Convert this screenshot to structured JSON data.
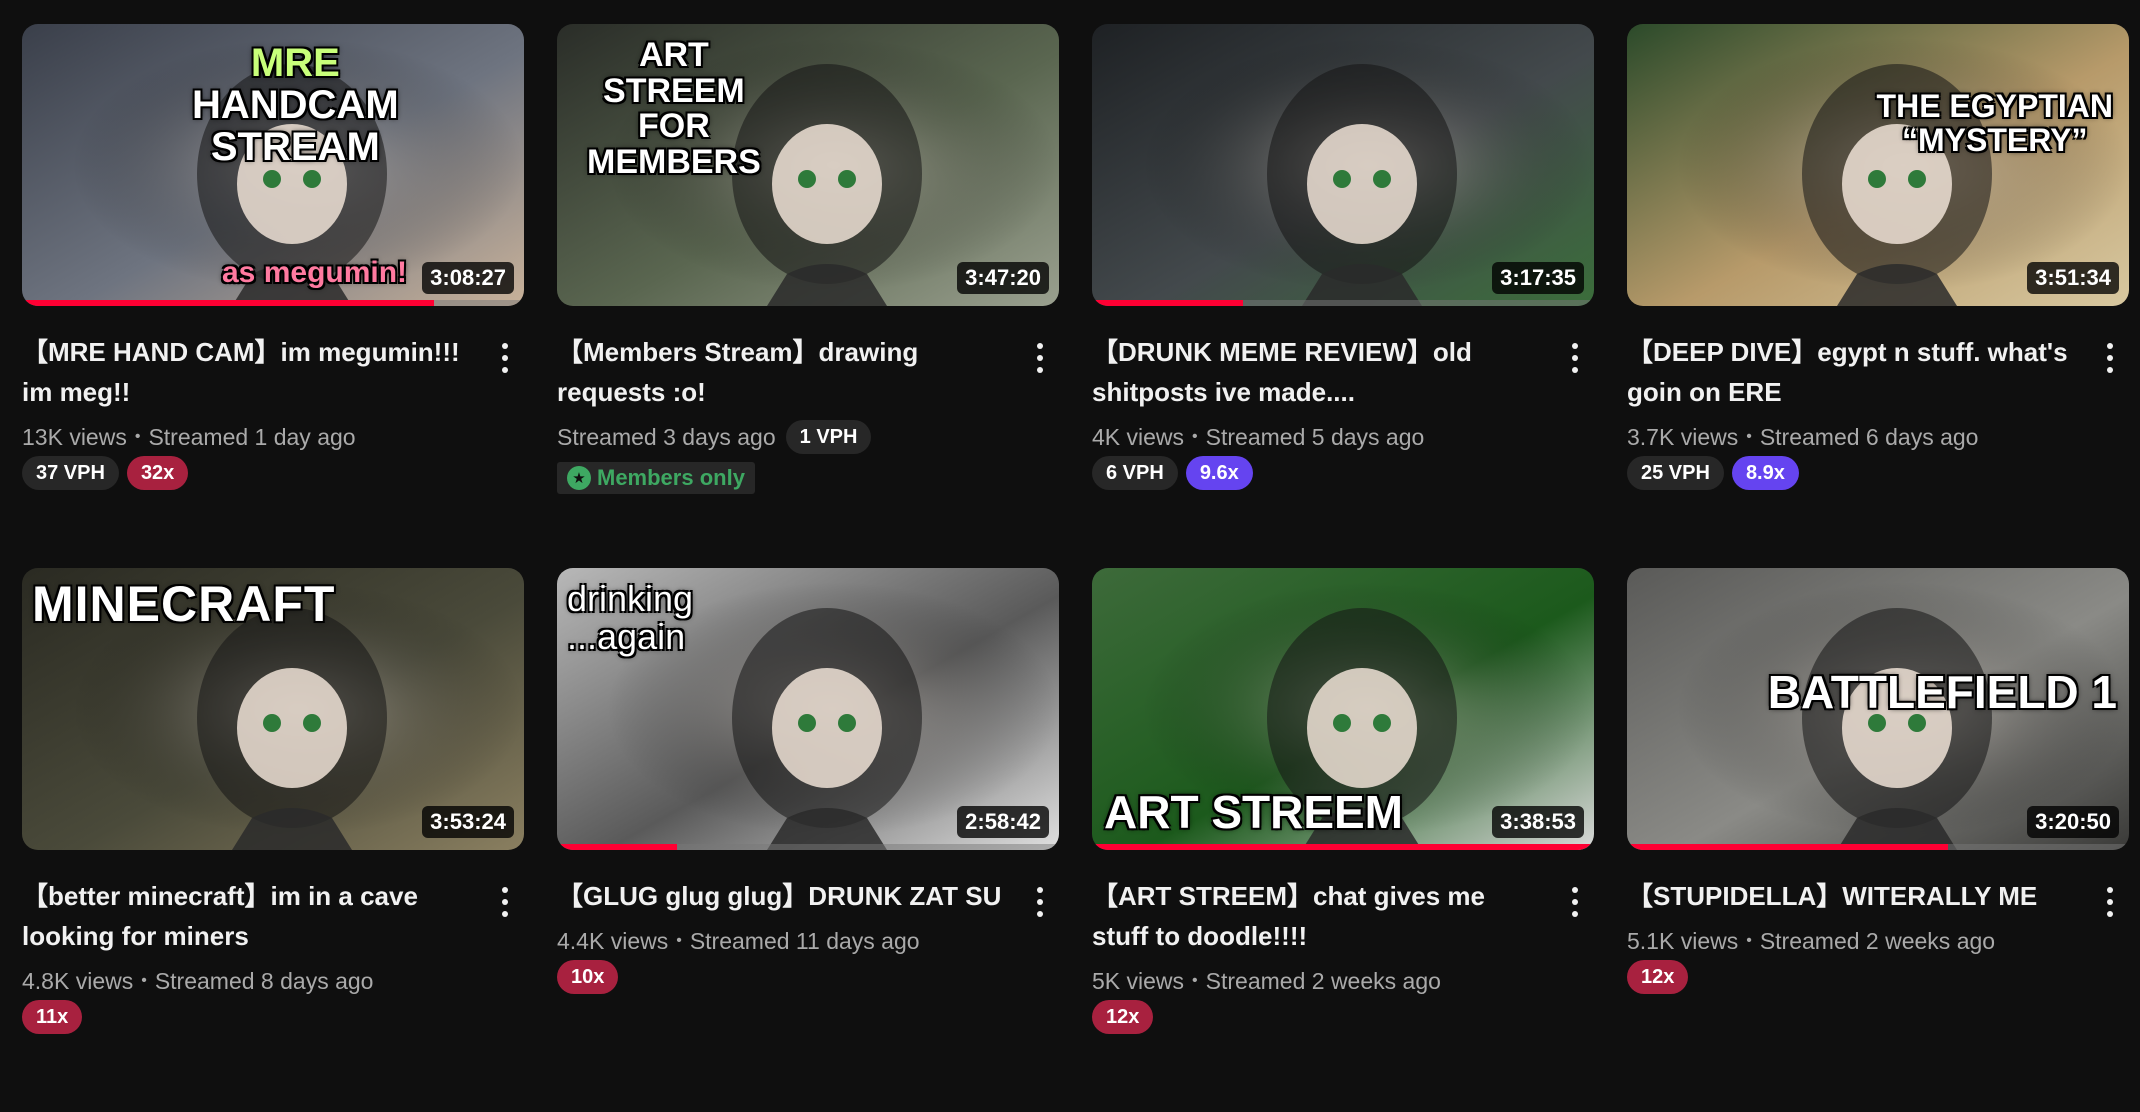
{
  "videos": [
    {
      "title": "【MRE HAND CAM】im megumin!!! im meg!!",
      "thumb_text": [
        "MRE",
        "HANDCAM",
        "STREAM"
      ],
      "thumb_sub": "as megumin!",
      "duration": "3:08:27",
      "progress": 0.82,
      "views": "13K views",
      "date": "Streamed 1 day ago",
      "vph": "37 VPH",
      "mult": "32x",
      "mult_color": "red",
      "bg": [
        "#3a3f4a",
        "#6e7480",
        "#c9b29a"
      ]
    },
    {
      "title": "【Members Stream】drawing requests :o!",
      "thumb_text": [
        "ART",
        "STREEM",
        "FOR",
        "MEMBERS"
      ],
      "duration": "3:47:20",
      "progress": 0,
      "views": "",
      "date": "Streamed 3 days ago",
      "vph": "1 VPH",
      "members_label": "Members only",
      "bg": [
        "#2a2d28",
        "#5a6650",
        "#9aa08f"
      ]
    },
    {
      "title": "【DRUNK MEME REVIEW】old shitposts ive made....",
      "duration": "3:17:35",
      "progress": 0.3,
      "views": "4K views",
      "date": "Streamed 5 days ago",
      "vph": "6 VPH",
      "mult": "9.6x",
      "mult_color": "purple",
      "bg": [
        "#1e2124",
        "#43494c",
        "#3b6e3b"
      ]
    },
    {
      "title": "【DEEP DIVE】egypt n stuff. what's goin on ERE",
      "thumb_text": [
        "THE EGYPTIAN",
        "“MYSTERY”"
      ],
      "duration": "3:51:34",
      "progress": 0,
      "views": "3.7K views",
      "date": "Streamed 6 days ago",
      "vph": "25 VPH",
      "mult": "8.9x",
      "mult_color": "purple",
      "bg": [
        "#2b4a2a",
        "#b79a6a",
        "#d8c8a0"
      ]
    },
    {
      "title": "【better minecraft】im in a cave looking for miners",
      "thumb_text": [
        "MINECRAFT"
      ],
      "duration": "3:53:24",
      "progress": 0,
      "views": "4.8K views",
      "date": "Streamed 8 days ago",
      "mult": "11x",
      "mult_color": "red",
      "bg": [
        "#2a2a22",
        "#4a4a3a",
        "#8a7f60"
      ]
    },
    {
      "title": "【GLUG glug glug】DRUNK ZAT SU",
      "thumb_text": [
        "drinking",
        "...again"
      ],
      "duration": "2:58:42",
      "progress": 0.24,
      "views": "4.4K views",
      "date": "Streamed 11 days ago",
      "mult": "10x",
      "mult_color": "red",
      "bg": [
        "#b8b8b8",
        "#5a5a5a",
        "#e0e0e0"
      ]
    },
    {
      "title": "【ART STREEM】chat gives me stuff to doodle!!!!",
      "thumb_text": [
        "ART STREEM"
      ],
      "duration": "3:38:53",
      "progress": 1.0,
      "views": "5K views",
      "date": "Streamed 2 weeks ago",
      "mult": "12x",
      "mult_color": "red",
      "bg": [
        "#3d6a3a",
        "#1c5a1c",
        "#d9d9d9"
      ]
    },
    {
      "title": "【STUPIDELLA】WITERALLY ME",
      "thumb_text": [
        "BATTLEFIELD 1"
      ],
      "duration": "3:20:50",
      "progress": 0.64,
      "views": "5.1K views",
      "date": "Streamed 2 weeks ago",
      "mult": "12x",
      "mult_color": "red",
      "bg": [
        "#5a5a58",
        "#8a8a86",
        "#3a3a38"
      ]
    }
  ]
}
